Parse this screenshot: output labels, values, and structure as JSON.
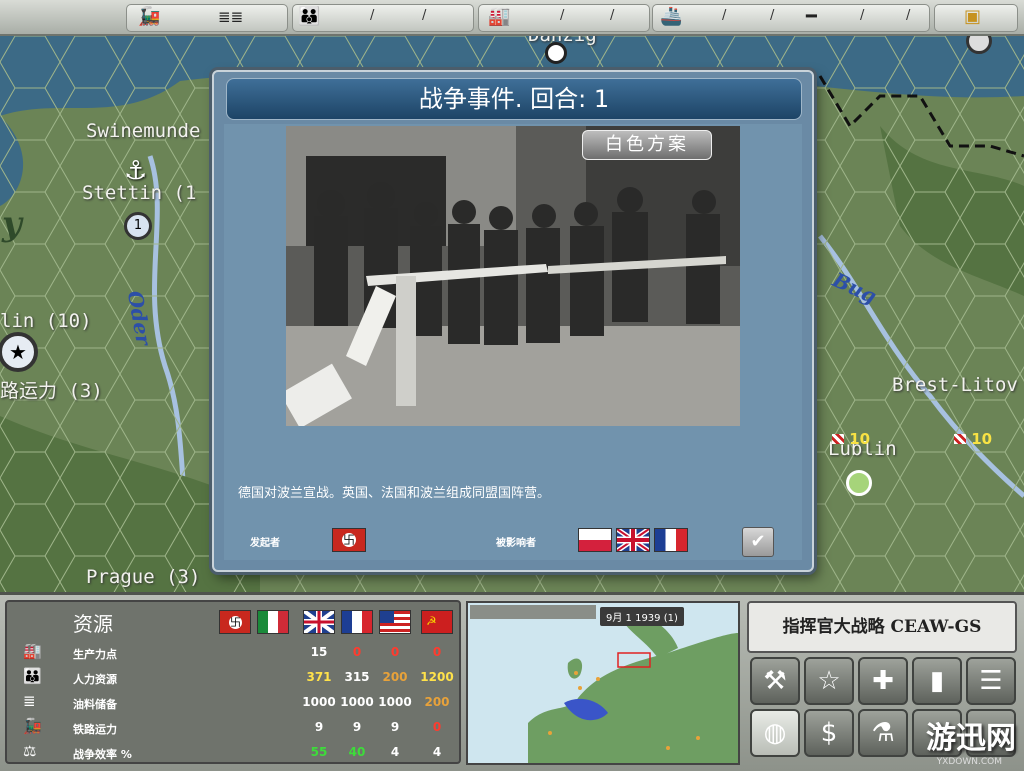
{
  "dialog": {
    "title": "战争事件. 回合: 1",
    "operation": "白色方案",
    "event_text": "德国对波兰宣战。英国、法国和波兰组成同盟国阵营。",
    "initiator_label": "发起者",
    "affected_label": "被影响者"
  },
  "map": {
    "cities": [
      {
        "name": "Swinemunde"
      },
      {
        "name": "Stettin (1"
      },
      {
        "name": "lin (10)"
      },
      {
        "name": "路运力 (3)"
      },
      {
        "name": "Prague (3)"
      },
      {
        "name": "Brest-Litov"
      },
      {
        "name": "Lublin"
      }
    ],
    "rivers": [
      "Oder",
      "Bug"
    ],
    "map_edge_text": [
      "y",
      "Danzig"
    ],
    "unit_strengths": [
      "10",
      "10"
    ]
  },
  "resources": {
    "title": "资源",
    "rows": [
      {
        "icon": "factory-icon",
        "label": "生产力点",
        "values": [
          "15",
          "0",
          "0",
          "0"
        ]
      },
      {
        "icon": "manpower-icon",
        "label": "人力资源",
        "values": [
          "371",
          "315",
          "200",
          "1200"
        ]
      },
      {
        "icon": "oil-icon",
        "label": "油料储备",
        "values": [
          "1000",
          "1000",
          "1000",
          "200"
        ]
      },
      {
        "icon": "rail-icon",
        "label": "铁路运力",
        "values": [
          "9",
          "9",
          "9",
          "0"
        ]
      },
      {
        "icon": "balance-icon",
        "label": "战争效率 %",
        "values": [
          "55",
          "40",
          "4",
          "4"
        ]
      }
    ],
    "value_colors": [
      [
        "#ffffff",
        "#ff3b2e",
        "#ff3b2e",
        "#ff3b2e"
      ],
      [
        "#ffe24a",
        "#ffffff",
        "#e8a23a",
        "#ffe24a"
      ],
      [
        "#ffffff",
        "#ffffff",
        "#ffffff",
        "#e8a23a"
      ],
      [
        "#ffffff",
        "#ffffff",
        "#ffffff",
        "#ff3b2e"
      ],
      [
        "#3ddc3a",
        "#3ddc3a",
        "#ffffff",
        "#ffffff"
      ]
    ]
  },
  "minimap": {
    "date": "9月 1 1939 (1)"
  },
  "game_title": "指挥官大战略 CEAW-GS",
  "watermark": {
    "main": "游迅网",
    "sub": "YXDOWN.COM"
  },
  "topbar": {
    "slash": "/"
  },
  "colors": {
    "dialog_bg": "#6a8aa5",
    "title_bar": "#1d4466"
  }
}
